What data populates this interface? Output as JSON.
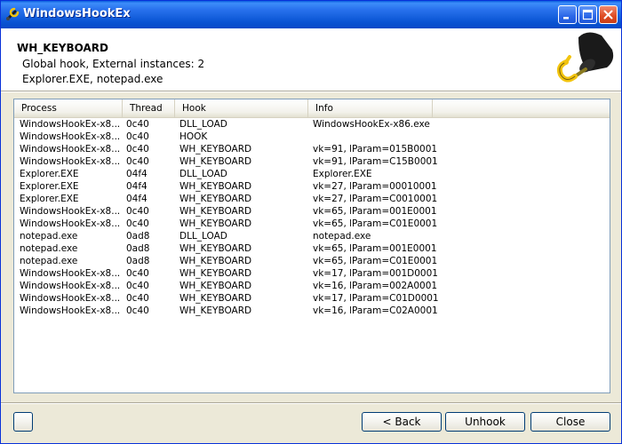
{
  "window": {
    "title": "WindowsHookEx",
    "icon": "hook-wrench-icon"
  },
  "header": {
    "title": "WH_KEYBOARD",
    "line1": "Global hook, External instances: 2",
    "line2": "Explorer.EXE, notepad.exe",
    "art_icon": "pirate-hook-icon"
  },
  "table": {
    "columns": [
      "Process",
      "Thread",
      "Hook",
      "Info"
    ],
    "rows": [
      [
        "WindowsHookEx-x8...",
        "0c40",
        "DLL_LOAD",
        "WindowsHookEx-x86.exe"
      ],
      [
        "WindowsHookEx-x8...",
        "0c40",
        "HOOK",
        ""
      ],
      [
        "WindowsHookEx-x8...",
        "0c40",
        "WH_KEYBOARD",
        "vk=91, lParam=015B0001"
      ],
      [
        "WindowsHookEx-x8...",
        "0c40",
        "WH_KEYBOARD",
        "vk=91, lParam=C15B0001"
      ],
      [
        "Explorer.EXE",
        "04f4",
        "DLL_LOAD",
        "Explorer.EXE"
      ],
      [
        "Explorer.EXE",
        "04f4",
        "WH_KEYBOARD",
        "vk=27, lParam=00010001"
      ],
      [
        "Explorer.EXE",
        "04f4",
        "WH_KEYBOARD",
        "vk=27, lParam=C0010001"
      ],
      [
        "WindowsHookEx-x8...",
        "0c40",
        "WH_KEYBOARD",
        "vk=65, lParam=001E0001"
      ],
      [
        "WindowsHookEx-x8...",
        "0c40",
        "WH_KEYBOARD",
        "vk=65, lParam=C01E0001"
      ],
      [
        "notepad.exe",
        "0ad8",
        "DLL_LOAD",
        "notepad.exe"
      ],
      [
        "notepad.exe",
        "0ad8",
        "WH_KEYBOARD",
        "vk=65, lParam=001E0001"
      ],
      [
        "notepad.exe",
        "0ad8",
        "WH_KEYBOARD",
        "vk=65, lParam=C01E0001"
      ],
      [
        "WindowsHookEx-x8...",
        "0c40",
        "WH_KEYBOARD",
        "vk=17, lParam=001D0001"
      ],
      [
        "WindowsHookEx-x8...",
        "0c40",
        "WH_KEYBOARD",
        "vk=16, lParam=002A0001"
      ],
      [
        "WindowsHookEx-x8...",
        "0c40",
        "WH_KEYBOARD",
        "vk=17, lParam=C01D0001"
      ],
      [
        "WindowsHookEx-x8...",
        "0c40",
        "WH_KEYBOARD",
        "vk=16, lParam=C02A0001"
      ]
    ]
  },
  "buttons": {
    "small": "",
    "back": "< Back",
    "unhook": "Unhook",
    "close": "Close"
  },
  "colors": {
    "titlebar": "#0a55d4",
    "window_bg": "#ece9d8",
    "close_button": "#de4b22",
    "hook_yellow": "#f2c40f"
  }
}
